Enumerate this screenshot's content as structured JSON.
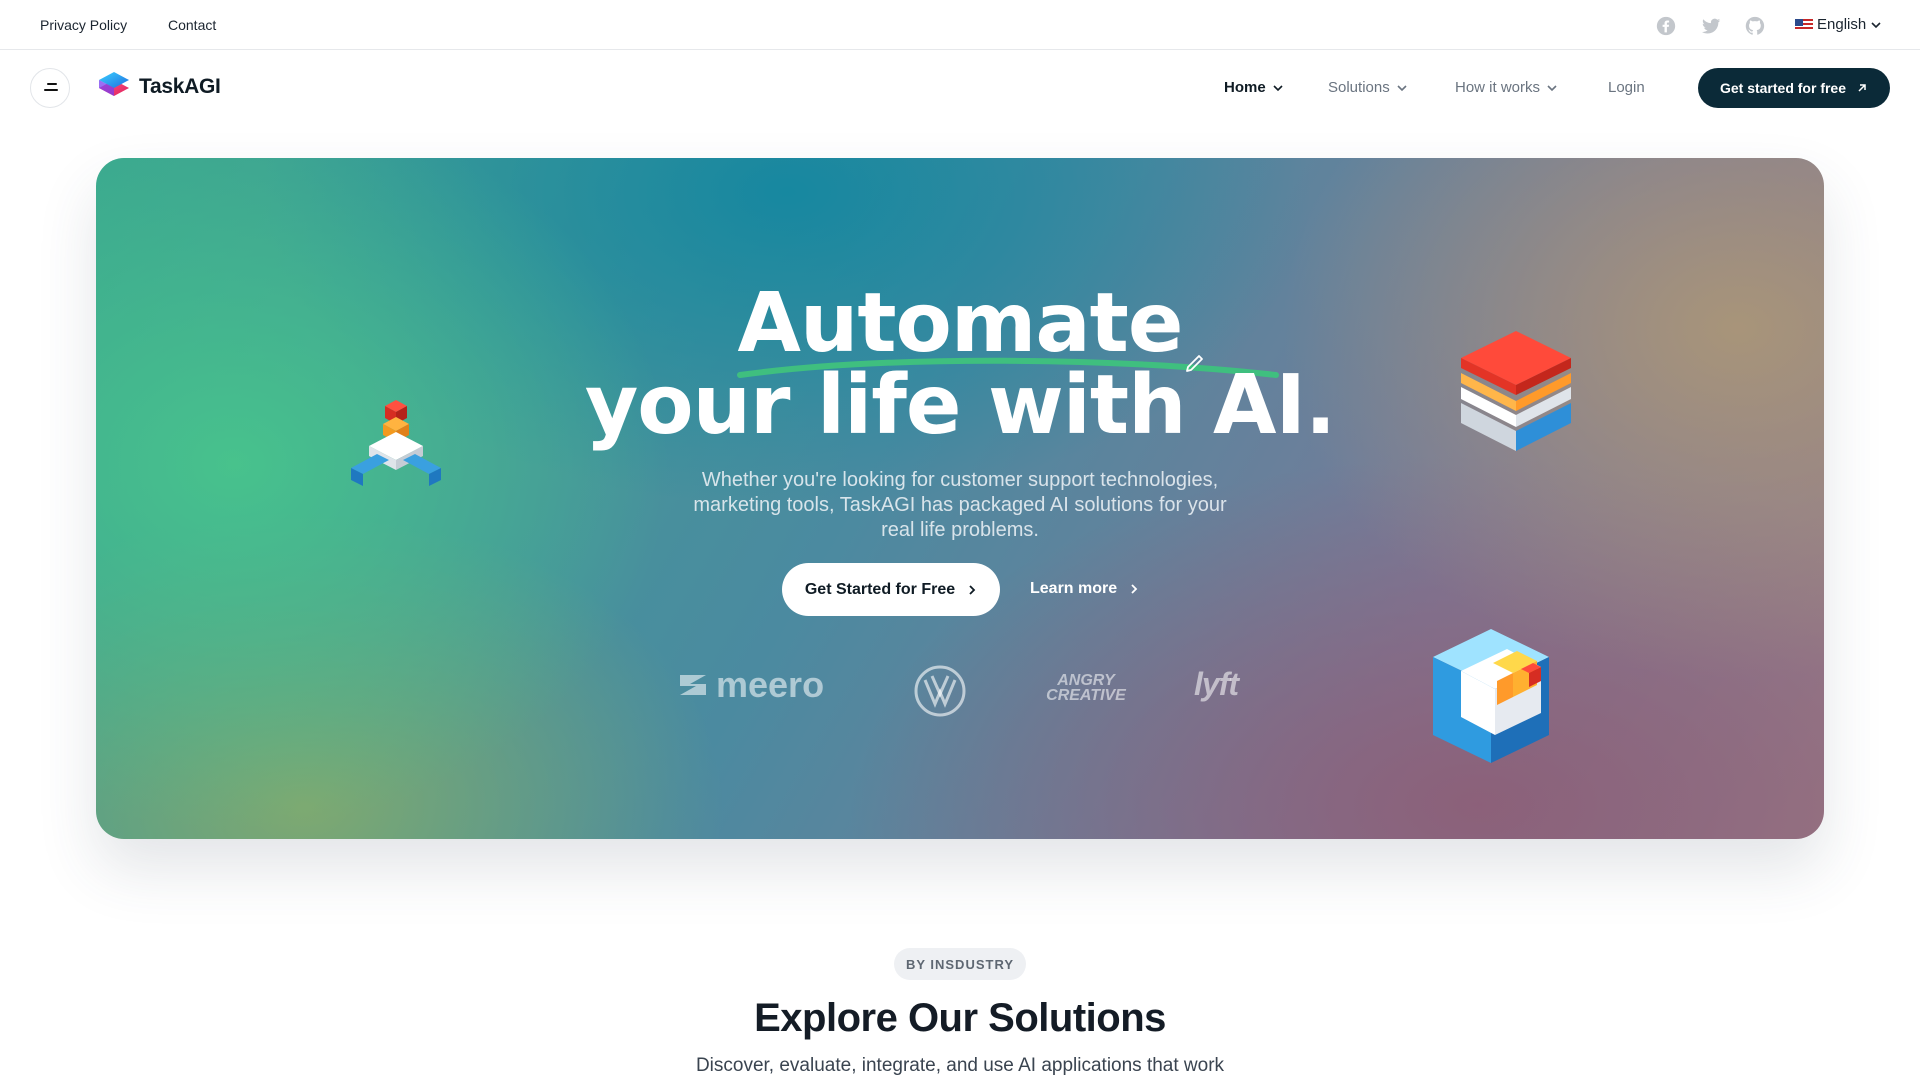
{
  "topbar": {
    "privacy": "Privacy Policy",
    "contact": "Contact",
    "social_icons": [
      "facebook-icon",
      "twitter-icon",
      "github-icon"
    ],
    "language": "English"
  },
  "nav": {
    "logo_text": "TaskAGI",
    "items": [
      {
        "label": "Home",
        "active": true
      },
      {
        "label": "Solutions",
        "active": false
      },
      {
        "label": "How it works",
        "active": false
      },
      {
        "label": "Login",
        "active": false
      }
    ],
    "cta": "Get started for free"
  },
  "hero": {
    "headline_1": "Automate",
    "headline_2": "your life with AI.",
    "subtitle": "Whether you're looking for customer support technologies, marketing tools, TaskAGI has packaged AI solutions for your real life problems.",
    "primary_button": "Get Started for Free",
    "secondary_button": "Learn more",
    "brands": [
      "meero",
      "VW",
      "ANGRY CREATIVE",
      "lyft"
    ]
  },
  "section": {
    "badge": "BY INSDUSTRY",
    "title": "Explore Our Solutions",
    "subtitle": "Discover, evaluate, integrate, and use AI applications that work"
  },
  "colors": {
    "cta_dark": "#0b2a38",
    "accent_green": "#3fbf7f"
  }
}
